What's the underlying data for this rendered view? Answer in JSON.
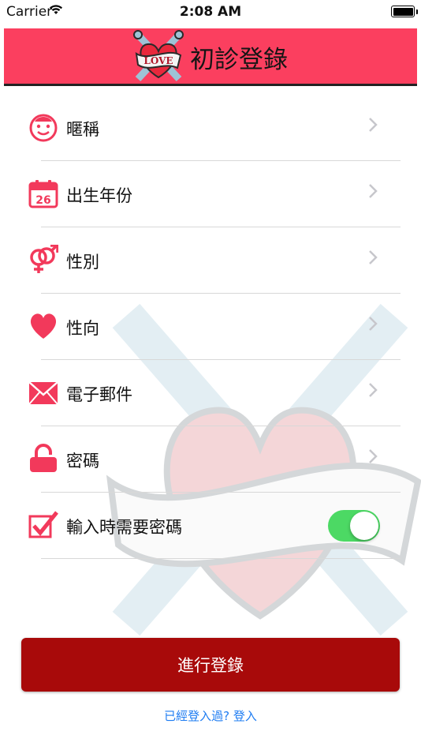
{
  "status_bar": {
    "carrier": "Carrier",
    "time": "2:08 AM"
  },
  "nav": {
    "title": "初診登錄",
    "logo_text": "LOVE"
  },
  "rows": [
    {
      "label": "暱稱",
      "icon": "face-icon",
      "chevron": true
    },
    {
      "label": "出生年份",
      "icon": "calendar-icon",
      "calendar_day": "26",
      "chevron": true
    },
    {
      "label": "性別",
      "icon": "gender-icon",
      "chevron": true
    },
    {
      "label": "性向",
      "icon": "heart-icon",
      "chevron": true
    },
    {
      "label": "電子郵件",
      "icon": "envelope-icon",
      "chevron": true
    },
    {
      "label": "密碼",
      "icon": "lock-icon",
      "chevron": true
    },
    {
      "label": "輸入時需要密碼",
      "icon": "checkbox-icon",
      "toggle_on": true
    }
  ],
  "colors": {
    "accent": "#fb3f5f",
    "button": "#a80a0a",
    "toggle": "#4cd964",
    "link": "#1e7cf2"
  },
  "signup_button": "進行登錄",
  "login_prompt": "已經登入過?  登入"
}
